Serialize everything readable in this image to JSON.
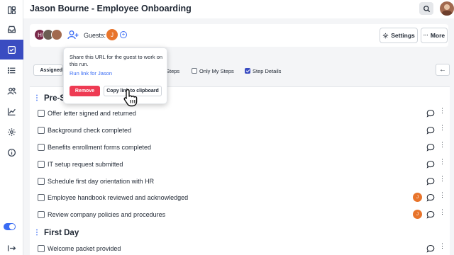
{
  "header": {
    "title": "Jason Bourne - Employee Onboarding",
    "search_icon": "search-icon",
    "avatar_icon": "user-avatar"
  },
  "sidebar": {
    "items": [
      {
        "icon": "layout-icon"
      },
      {
        "icon": "inbox-icon"
      },
      {
        "icon": "checklist-icon",
        "active": true
      },
      {
        "icon": "list-icon"
      },
      {
        "icon": "users-icon"
      },
      {
        "icon": "chart-icon"
      },
      {
        "icon": "gear-icon"
      },
      {
        "icon": "info-icon"
      },
      {
        "icon": "toggle"
      },
      {
        "icon": "logout-icon"
      }
    ]
  },
  "runbar": {
    "assignees": [
      {
        "initial": "H",
        "color": "#7a2a4a"
      },
      {
        "initial": "",
        "color": "#6b5d52"
      },
      {
        "initial": "",
        "color": "#a26a4f"
      }
    ],
    "guests_label": "Guests:",
    "guest_initial": "J",
    "guest_color": "#e8742b",
    "add_guest": "+",
    "settings_label": "Settings",
    "more_label": "More",
    "more_prefix": "···"
  },
  "filters": {
    "assignee_label": "Assigned",
    "steps_label": "Steps",
    "only_my_steps_label": "Only My Steps",
    "only_my_steps_checked": false,
    "step_details_label": "Step Details",
    "step_details_checked": true,
    "back_arrow": "←"
  },
  "popover": {
    "text": "Share this URL for the guest to work on this run.",
    "link": "Run link for Jason",
    "remove_label": "Remove",
    "copy_label": "Copy link to clipboard"
  },
  "sections": [
    {
      "title": "Pre-Start",
      "tasks": [
        {
          "name": "Offer letter signed and returned",
          "assignee": ""
        },
        {
          "name": "Background check completed",
          "assignee": ""
        },
        {
          "name": "Benefits enrollment forms completed",
          "assignee": ""
        },
        {
          "name": "IT setup request submitted",
          "assignee": ""
        },
        {
          "name": "Schedule first day orientation with HR",
          "assignee": ""
        },
        {
          "name": "Employee handbook reviewed and acknowledged",
          "assignee": "J"
        },
        {
          "name": "Review company policies and procedures",
          "assignee": "J"
        }
      ]
    },
    {
      "title": "First Day",
      "tasks": [
        {
          "name": "Welcome packet provided",
          "assignee": ""
        }
      ]
    }
  ],
  "colors": {
    "accent": "#3a4cc1",
    "link": "#3a6cf4",
    "danger": "#ee3b53",
    "guest_orange": "#e8742b"
  }
}
